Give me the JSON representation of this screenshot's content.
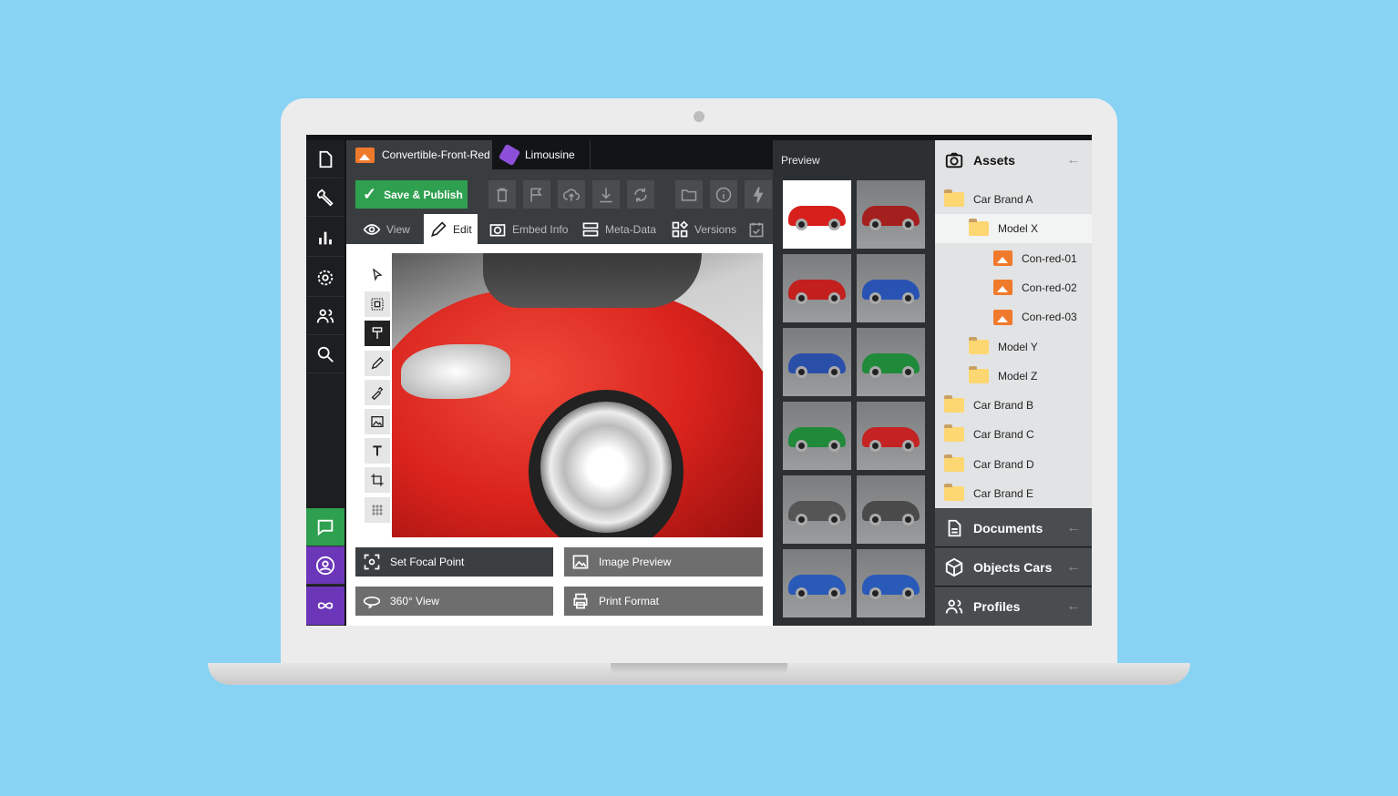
{
  "tabs": [
    {
      "label": "Convertible-Front-Red",
      "icon": "image-icon"
    },
    {
      "label": "Limousine",
      "icon": "cube-icon"
    }
  ],
  "toolbar": {
    "save_label": "Save & Publish",
    "icons": [
      "trash-icon",
      "flag-icon",
      "cloud-upload-icon",
      "download-icon",
      "refresh-icon",
      "folder-icon",
      "info-icon",
      "lightning-icon"
    ]
  },
  "view_tabs": [
    {
      "label": "View"
    },
    {
      "label": "Edit",
      "active": true
    },
    {
      "label": "Embed Info"
    },
    {
      "label": "Meta-Data"
    },
    {
      "label": "Versions"
    }
  ],
  "tools": [
    "pointer",
    "select",
    "paint-roller",
    "pencil",
    "eyedropper",
    "image",
    "text",
    "crop",
    "grid"
  ],
  "actions": {
    "focal": "Set Focal Point",
    "image_preview": "Image Preview",
    "view360": "360° View",
    "print": "Print Format"
  },
  "preview": {
    "title": "Preview",
    "thumbs": [
      "#d7201c",
      "#a3201e",
      "#c21f1d",
      "#2853b3",
      "#2a4fa8",
      "#1f8a3a",
      "#1f8a3a",
      "#c52323",
      "#555555",
      "#4a4a4a",
      "#2a5ab8",
      "#2a5ab8"
    ]
  },
  "assets": {
    "title": "Assets",
    "items": [
      {
        "label": "Car Brand A",
        "type": "folder",
        "level": 0
      },
      {
        "label": "Model X",
        "type": "folder",
        "level": 1,
        "selected": true
      },
      {
        "label": "Con-red-01",
        "type": "image",
        "level": 2
      },
      {
        "label": "Con-red-02",
        "type": "image",
        "level": 2
      },
      {
        "label": "Con-red-03",
        "type": "image",
        "level": 2
      },
      {
        "label": "Model Y",
        "type": "folder",
        "level": 1
      },
      {
        "label": "Model Z",
        "type": "folder",
        "level": 1
      },
      {
        "label": "Car Brand B",
        "type": "folder",
        "level": 0
      },
      {
        "label": "Car Brand C",
        "type": "folder",
        "level": 0
      },
      {
        "label": "Car Brand D",
        "type": "folder",
        "level": 0
      },
      {
        "label": "Car Brand E",
        "type": "folder",
        "level": 0
      }
    ]
  },
  "sections": [
    {
      "label": "Documents"
    },
    {
      "label": "Objects Cars"
    },
    {
      "label": "Profiles"
    }
  ],
  "colors": {
    "accent_green": "#2ea04f",
    "accent_purple": "#6b36b8",
    "background": "#88d3f4"
  }
}
